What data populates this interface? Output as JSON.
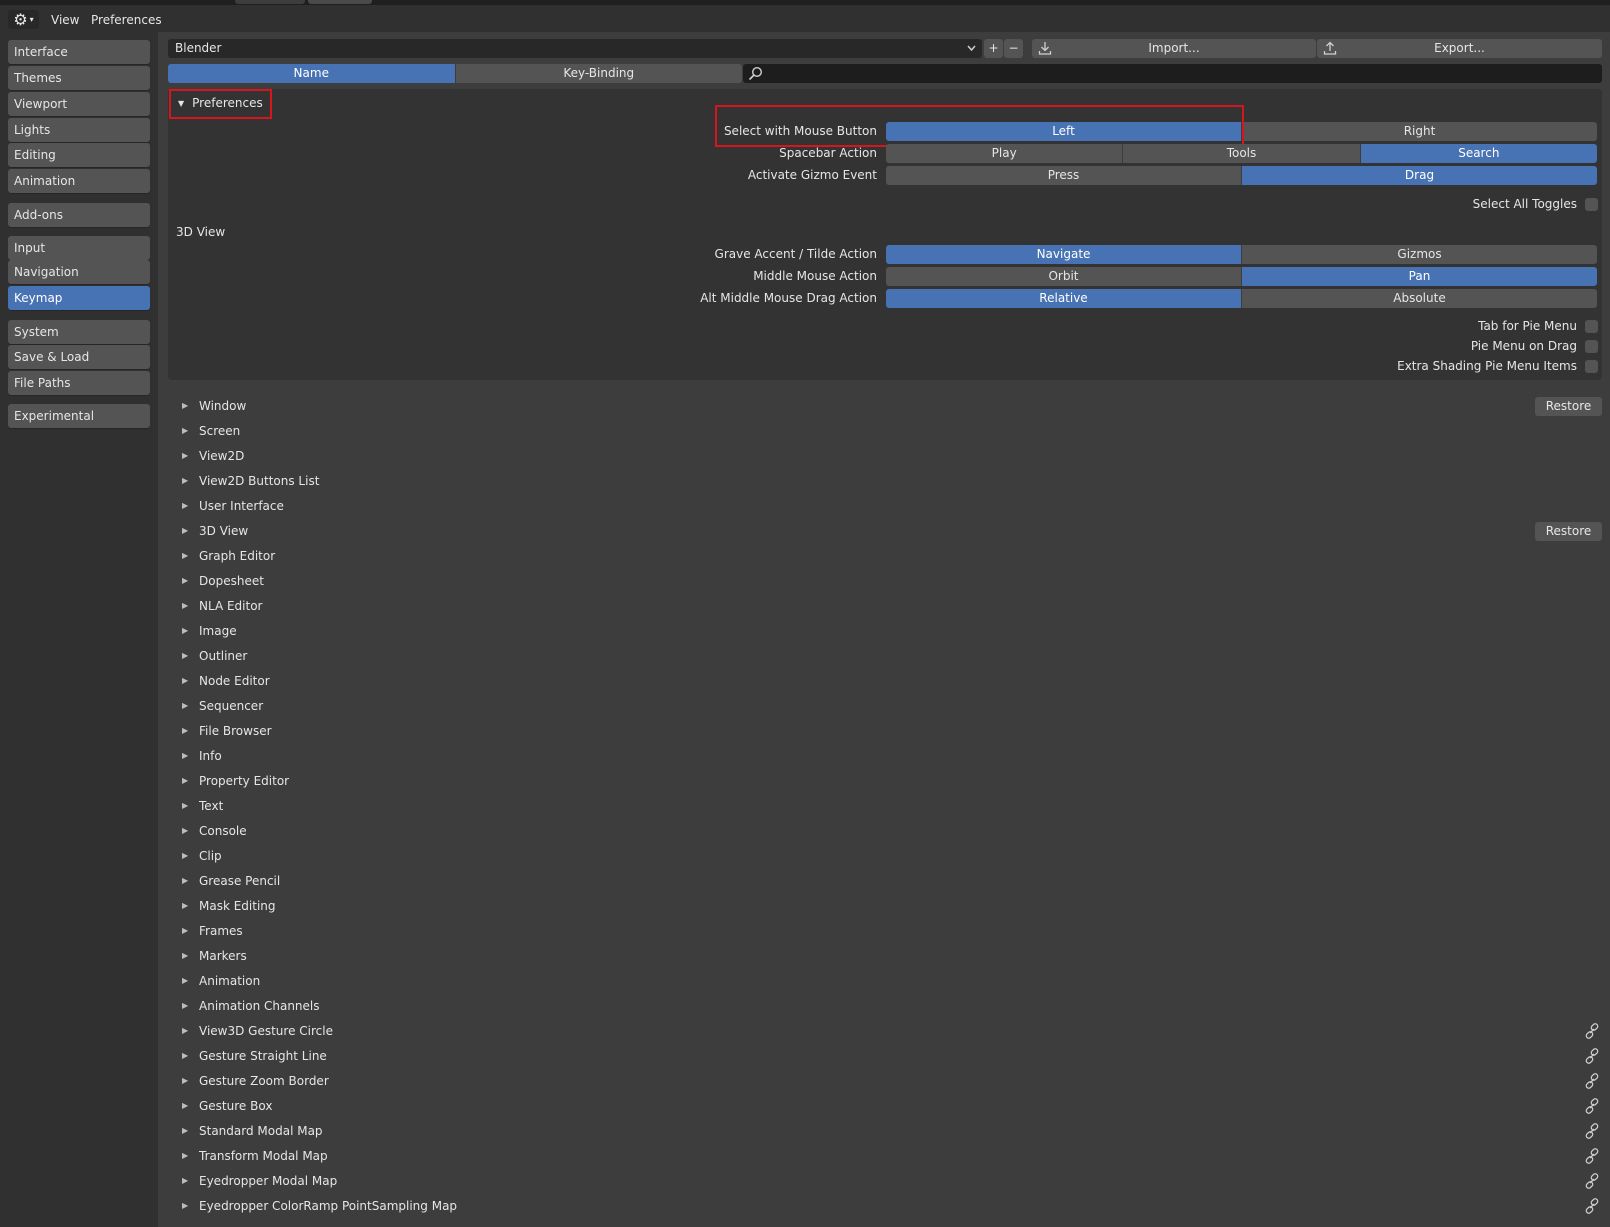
{
  "header": {
    "editor_icon": "gear-icon",
    "menus": [
      "View",
      "Preferences"
    ]
  },
  "sidebar": {
    "items": [
      {
        "label": "Interface"
      },
      {
        "label": "Themes"
      },
      {
        "label": "Viewport"
      },
      {
        "label": "Lights"
      },
      {
        "label": "Editing"
      },
      {
        "label": "Animation"
      },
      {
        "label": "Add-ons"
      },
      {
        "label": "Input"
      },
      {
        "label": "Navigation"
      },
      {
        "label": "Keymap",
        "active": true
      },
      {
        "label": "System"
      },
      {
        "label": "Save & Load"
      },
      {
        "label": "File Paths"
      },
      {
        "label": "Experimental"
      }
    ]
  },
  "toolbar": {
    "preset_value": "Blender",
    "add_label": "+",
    "remove_label": "−",
    "import_label": "Import...",
    "export_label": "Export...",
    "filter_tabs": [
      "Name",
      "Key-Binding"
    ],
    "filter_active": "Name",
    "search_value": ""
  },
  "preferences_panel": {
    "title": "Preferences",
    "select_mouse": {
      "label": "Select with Mouse Button",
      "options": [
        "Left",
        "Right"
      ],
      "selected": "Left"
    },
    "spacebar": {
      "label": "Spacebar Action",
      "options": [
        "Play",
        "Tools",
        "Search"
      ],
      "selected": "Search"
    },
    "gizmo_event": {
      "label": "Activate Gizmo Event",
      "options": [
        "Press",
        "Drag"
      ],
      "selected": "Drag"
    },
    "select_all_toggles": "Select All Toggles",
    "section_3d": "3D View",
    "grave_accent": {
      "label": "Grave Accent / Tilde Action",
      "options": [
        "Navigate",
        "Gizmos"
      ],
      "selected": "Navigate"
    },
    "middle_mouse": {
      "label": "Middle Mouse Action",
      "options": [
        "Orbit",
        "Pan"
      ],
      "selected": "Pan"
    },
    "alt_mmb": {
      "label": "Alt Middle Mouse Drag Action",
      "options": [
        "Relative",
        "Absolute"
      ],
      "selected": "Relative"
    },
    "tab_pie": "Tab for Pie Menu",
    "pie_drag": "Pie Menu on Drag",
    "extra_shading": "Extra Shading Pie Menu Items"
  },
  "keymap_list": {
    "restore_label": "Restore",
    "items": [
      {
        "label": "Window",
        "restore": true
      },
      {
        "label": "Screen"
      },
      {
        "label": "View2D"
      },
      {
        "label": "View2D Buttons List"
      },
      {
        "label": "User Interface"
      },
      {
        "label": "3D View",
        "restore": true
      },
      {
        "label": "Graph Editor"
      },
      {
        "label": "Dopesheet"
      },
      {
        "label": "NLA Editor"
      },
      {
        "label": "Image"
      },
      {
        "label": "Outliner"
      },
      {
        "label": "Node Editor"
      },
      {
        "label": "Sequencer"
      },
      {
        "label": "File Browser"
      },
      {
        "label": "Info"
      },
      {
        "label": "Property Editor"
      },
      {
        "label": "Text"
      },
      {
        "label": "Console"
      },
      {
        "label": "Clip"
      },
      {
        "label": "Grease Pencil"
      },
      {
        "label": "Mask Editing"
      },
      {
        "label": "Frames"
      },
      {
        "label": "Markers"
      },
      {
        "label": "Animation"
      },
      {
        "label": "Animation Channels"
      },
      {
        "label": "View3D Gesture Circle",
        "link": true
      },
      {
        "label": "Gesture Straight Line",
        "link": true
      },
      {
        "label": "Gesture Zoom Border",
        "link": true
      },
      {
        "label": "Gesture Box",
        "link": true
      },
      {
        "label": "Standard Modal Map",
        "link": true
      },
      {
        "label": "Transform Modal Map",
        "link": true
      },
      {
        "label": "Eyedropper Modal Map",
        "link": true
      },
      {
        "label": "Eyedropper ColorRamp PointSampling Map",
        "link": true
      }
    ]
  },
  "colors": {
    "accent": "#4772b3",
    "highlight_box": "#d5161f",
    "background": "#3d3d3d",
    "button": "#545454"
  }
}
